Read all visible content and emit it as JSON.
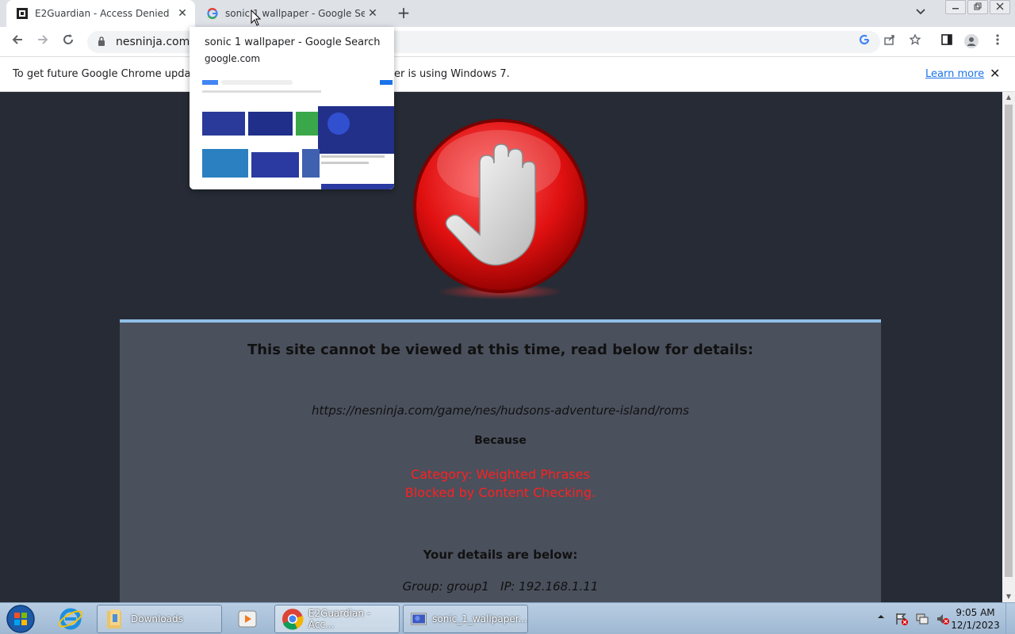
{
  "browser": {
    "tabs": [
      {
        "title": "E2Guardian - Access Denied",
        "favicon": "e2guardian-icon"
      },
      {
        "title": "sonic 1 wallpaper - Google Search",
        "favicon": "google-icon"
      }
    ],
    "close_glyph": "✕",
    "new_tab_glyph": "+",
    "address": "nesninja.com/ga",
    "infobar": {
      "message_start": "To get future Google Chrome updates,",
      "message_end": "er is using Windows 7.",
      "learn_more": "Learn more"
    },
    "hover_card": {
      "title": "sonic 1 wallpaper - Google Search",
      "domain": "google.com"
    }
  },
  "page": {
    "heading": "This site cannot be viewed at this time, read below for details:",
    "blocked_url": "https://nesninja.com/game/nes/hudsons-adventure-island/roms",
    "because": "Because",
    "category": "Category: Weighted Phrases",
    "reason": "Blocked by Content Checking.",
    "details_heading": "Your details are below:",
    "group_info": "Group: group1   IP: 192.168.1.11",
    "accent_color": "#ff2020"
  },
  "taskbar": {
    "items": [
      {
        "label": "Downloads"
      },
      {
        "label": "E2Guardian - Acc..."
      },
      {
        "label": "sonic_1_wallpaper..."
      }
    ],
    "clock_time": "9:05 AM",
    "clock_date": "12/1/2023"
  }
}
